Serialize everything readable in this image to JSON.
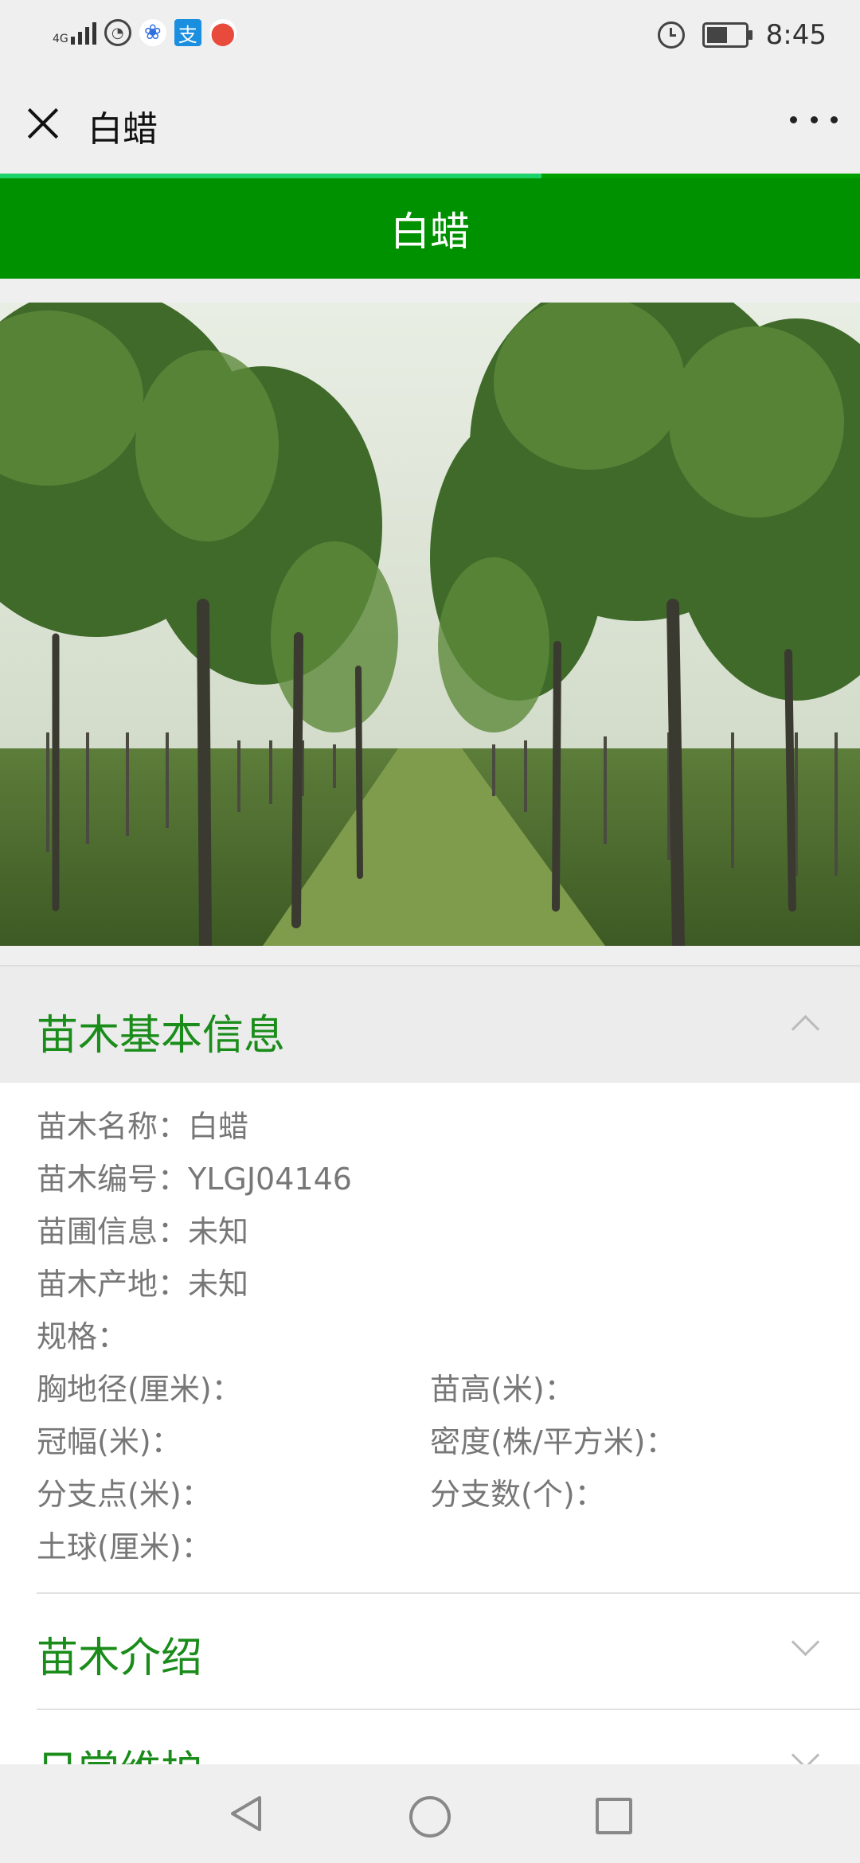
{
  "status_bar": {
    "network": "4G",
    "time": "8:45",
    "battery_level": 0.55,
    "icons": [
      "signal-icon",
      "browser-icon",
      "baidu-paw-icon",
      "alipay-icon",
      "map-pin-icon",
      "alarm-icon",
      "battery-icon"
    ]
  },
  "titlebar": {
    "title": "白蜡",
    "close_icon": "close-icon",
    "more_icon": "more-icon"
  },
  "page_load_progress": 0.63,
  "header": {
    "title": "白蜡"
  },
  "photo": {
    "subject": "tree-photo"
  },
  "basic_info": {
    "title": "苗木基本信息",
    "expanded": true,
    "name": "苗木名称：白蜡",
    "code": "苗木编号：YLGJ04146",
    "nursery": "苗圃信息：未知",
    "origin": "苗木产地：未知",
    "spec": "规格：",
    "dbh": "胸地径(厘米)：",
    "height": "苗高(米)：",
    "crown": "冠幅(米)：",
    "density": "密度(株/平方米)：",
    "branch_point": "分支点(米)：",
    "branch_count": "分支数(个)：",
    "soil_ball": "土球(厘米)："
  },
  "sections": [
    {
      "title": "苗木介绍",
      "expanded": false
    },
    {
      "title": "日常维护",
      "expanded": false
    }
  ],
  "nav_bar": {
    "icons": [
      "back-icon",
      "home-icon",
      "recent-apps-icon"
    ]
  },
  "colors": {
    "accent_green": "#009100",
    "title_green": "#1a8c1a",
    "progress": "#1bd36a"
  }
}
